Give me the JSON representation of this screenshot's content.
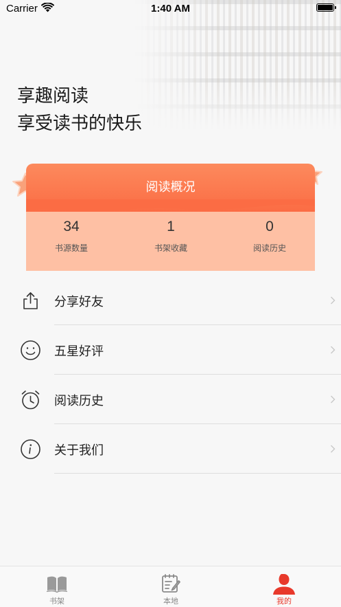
{
  "status_bar": {
    "carrier": "Carrier",
    "time": "1:40 AM"
  },
  "slogan": {
    "line1": "享趣阅读",
    "line2": "享受读书的快乐"
  },
  "stats": {
    "title": "阅读概况",
    "items": [
      {
        "value": "34",
        "label": "书源数量"
      },
      {
        "value": "1",
        "label": "书架收藏"
      },
      {
        "value": "0",
        "label": "阅读历史"
      }
    ]
  },
  "menu": {
    "items": [
      {
        "label": "分享好友",
        "icon": "share-icon"
      },
      {
        "label": "五星好评",
        "icon": "smiley-icon"
      },
      {
        "label": "阅读历史",
        "icon": "alarm-clock-icon"
      },
      {
        "label": "关于我们",
        "icon": "info-icon"
      }
    ]
  },
  "tab_bar": {
    "tabs": [
      {
        "label": "书架",
        "icon": "open-book-icon",
        "active": false
      },
      {
        "label": "本地",
        "icon": "notepad-edit-icon",
        "active": false
      },
      {
        "label": "我的",
        "icon": "user-icon",
        "active": true
      }
    ]
  },
  "colors": {
    "accent": "#e8392b",
    "card_header": "#fb7a50",
    "card_body": "#fec0a4"
  }
}
